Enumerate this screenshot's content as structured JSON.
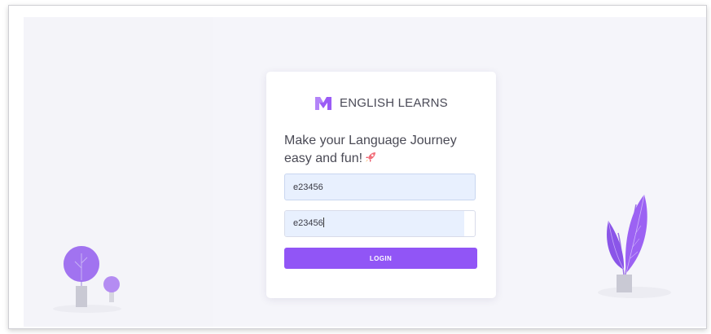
{
  "brand": {
    "name": "ENGLISH LEARNS",
    "logo_icon": "m-logo-icon"
  },
  "tagline": "Make your Language Journey easy and fun!",
  "form": {
    "username_value": "e23456",
    "password_value": "e23456",
    "login_label": "LOGIN"
  },
  "colors": {
    "accent": "#9155f6",
    "field_fill": "#e8f0fe",
    "background": "#f4f4f9",
    "card": "#ffffff"
  }
}
